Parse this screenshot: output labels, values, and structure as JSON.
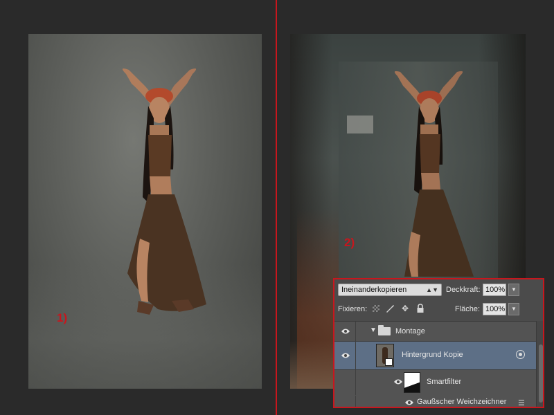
{
  "annotations": {
    "label_left": "1)",
    "label_right": "2)"
  },
  "colors": {
    "annotation_red": "#c8161d",
    "panel_bg": "#4b4b4b",
    "selected_row": "#5d6f86"
  },
  "layers_panel": {
    "blend_mode": "Ineinanderkopieren",
    "opacity_label": "Deckkraft:",
    "opacity_value": "100%",
    "lock_label": "Fixieren:",
    "fill_label": "Fläche:",
    "fill_value": "100%",
    "lock_icons": [
      "transparency-lock-icon",
      "brush-lock-icon",
      "move-lock-icon",
      "padlock-icon"
    ],
    "layers": [
      {
        "name": "Montage",
        "type": "group",
        "expanded": true
      },
      {
        "name": "Hintergrund Kopie",
        "type": "smart-object",
        "selected": true
      },
      {
        "name": "Smartfilter",
        "type": "smart-filter-mask"
      },
      {
        "name": "Gaußscher Weichzeichner",
        "type": "filter"
      }
    ]
  }
}
